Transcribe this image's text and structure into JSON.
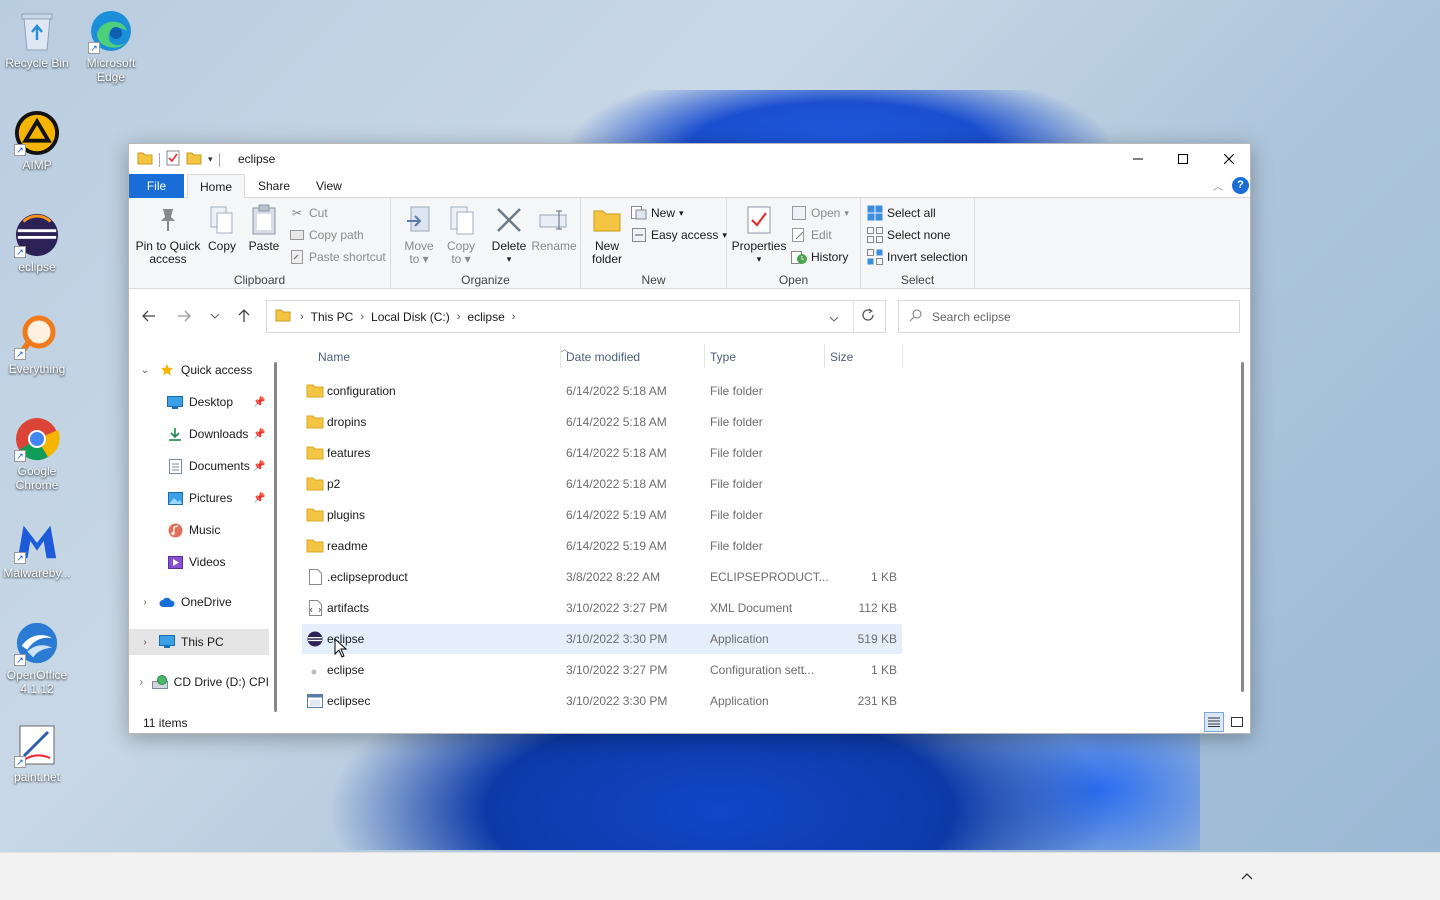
{
  "desktop": {
    "icons": [
      {
        "label": "Recycle Bin",
        "icon": "recycle-bin-icon"
      },
      {
        "label": "Microsoft Edge",
        "icon": "edge-icon"
      },
      {
        "label": "AIMP",
        "icon": "aimp-icon"
      },
      {
        "label": "eclipse",
        "icon": "eclipse-icon"
      },
      {
        "label": "Everything",
        "icon": "everything-icon"
      },
      {
        "label": "Google Chrome",
        "icon": "chrome-icon"
      },
      {
        "label": "Malwareby...",
        "icon": "malwarebytes-icon"
      },
      {
        "label": "OpenOffice 4.1.12",
        "icon": "openoffice-icon"
      },
      {
        "label": "paint.net",
        "icon": "paintnet-icon"
      }
    ]
  },
  "window": {
    "title": "eclipse",
    "tabs": {
      "file": "File",
      "home": "Home",
      "share": "Share",
      "view": "View"
    },
    "ribbon": {
      "clipboard": {
        "label": "Clipboard",
        "pin": "Pin to Quick access",
        "copy": "Copy",
        "paste": "Paste",
        "cut": "Cut",
        "copy_path": "Copy path",
        "paste_shortcut": "Paste shortcut"
      },
      "organize": {
        "label": "Organize",
        "move_to": "Move to",
        "copy_to": "Copy to",
        "delete": "Delete",
        "rename": "Rename"
      },
      "new": {
        "label": "New",
        "new_folder": "New folder",
        "new_item": "New",
        "easy_access": "Easy access"
      },
      "open": {
        "label": "Open",
        "properties": "Properties",
        "open": "Open",
        "edit": "Edit",
        "history": "History"
      },
      "select": {
        "label": "Select",
        "select_all": "Select all",
        "select_none": "Select none",
        "invert": "Invert selection"
      }
    },
    "address": {
      "crumbs": [
        "This PC",
        "Local Disk (C:)",
        "eclipse"
      ],
      "search_placeholder": "Search eclipse"
    },
    "nav": {
      "quick_access": "Quick access",
      "desktop": "Desktop",
      "downloads": "Downloads",
      "documents": "Documents",
      "pictures": "Pictures",
      "music": "Music",
      "videos": "Videos",
      "onedrive": "OneDrive",
      "this_pc": "This PC",
      "cd_drive": "CD Drive (D:) CPI"
    },
    "columns": {
      "name": "Name",
      "date": "Date modified",
      "type": "Type",
      "size": "Size"
    },
    "files": [
      {
        "name": "configuration",
        "date": "6/14/2022 5:18 AM",
        "type": "File folder",
        "size": "",
        "icon": "folder-icon"
      },
      {
        "name": "dropins",
        "date": "6/14/2022 5:18 AM",
        "type": "File folder",
        "size": "",
        "icon": "folder-icon"
      },
      {
        "name": "features",
        "date": "6/14/2022 5:18 AM",
        "type": "File folder",
        "size": "",
        "icon": "folder-icon"
      },
      {
        "name": "p2",
        "date": "6/14/2022 5:18 AM",
        "type": "File folder",
        "size": "",
        "icon": "folder-icon"
      },
      {
        "name": "plugins",
        "date": "6/14/2022 5:19 AM",
        "type": "File folder",
        "size": "",
        "icon": "folder-icon"
      },
      {
        "name": "readme",
        "date": "6/14/2022 5:19 AM",
        "type": "File folder",
        "size": "",
        "icon": "folder-icon"
      },
      {
        "name": ".eclipseproduct",
        "date": "3/8/2022 8:22 AM",
        "type": "ECLIPSEPRODUCT...",
        "size": "1 KB",
        "icon": "file-icon"
      },
      {
        "name": "artifacts",
        "date": "3/10/2022 3:27 PM",
        "type": "XML Document",
        "size": "112 KB",
        "icon": "xml-file-icon"
      },
      {
        "name": "eclipse",
        "date": "3/10/2022 3:30 PM",
        "type": "Application",
        "size": "519 KB",
        "icon": "eclipse-app-icon"
      },
      {
        "name": "eclipse",
        "date": "3/10/2022 3:27 PM",
        "type": "Configuration sett...",
        "size": "1 KB",
        "icon": "config-file-icon"
      },
      {
        "name": "eclipsec",
        "date": "3/10/2022 3:30 PM",
        "type": "Application",
        "size": "231 KB",
        "icon": "console-app-icon"
      }
    ],
    "status": "11 items"
  },
  "colors": {
    "accent": "#1a6dd6",
    "folder": "#f4c542",
    "selection": "#e5eefb"
  }
}
